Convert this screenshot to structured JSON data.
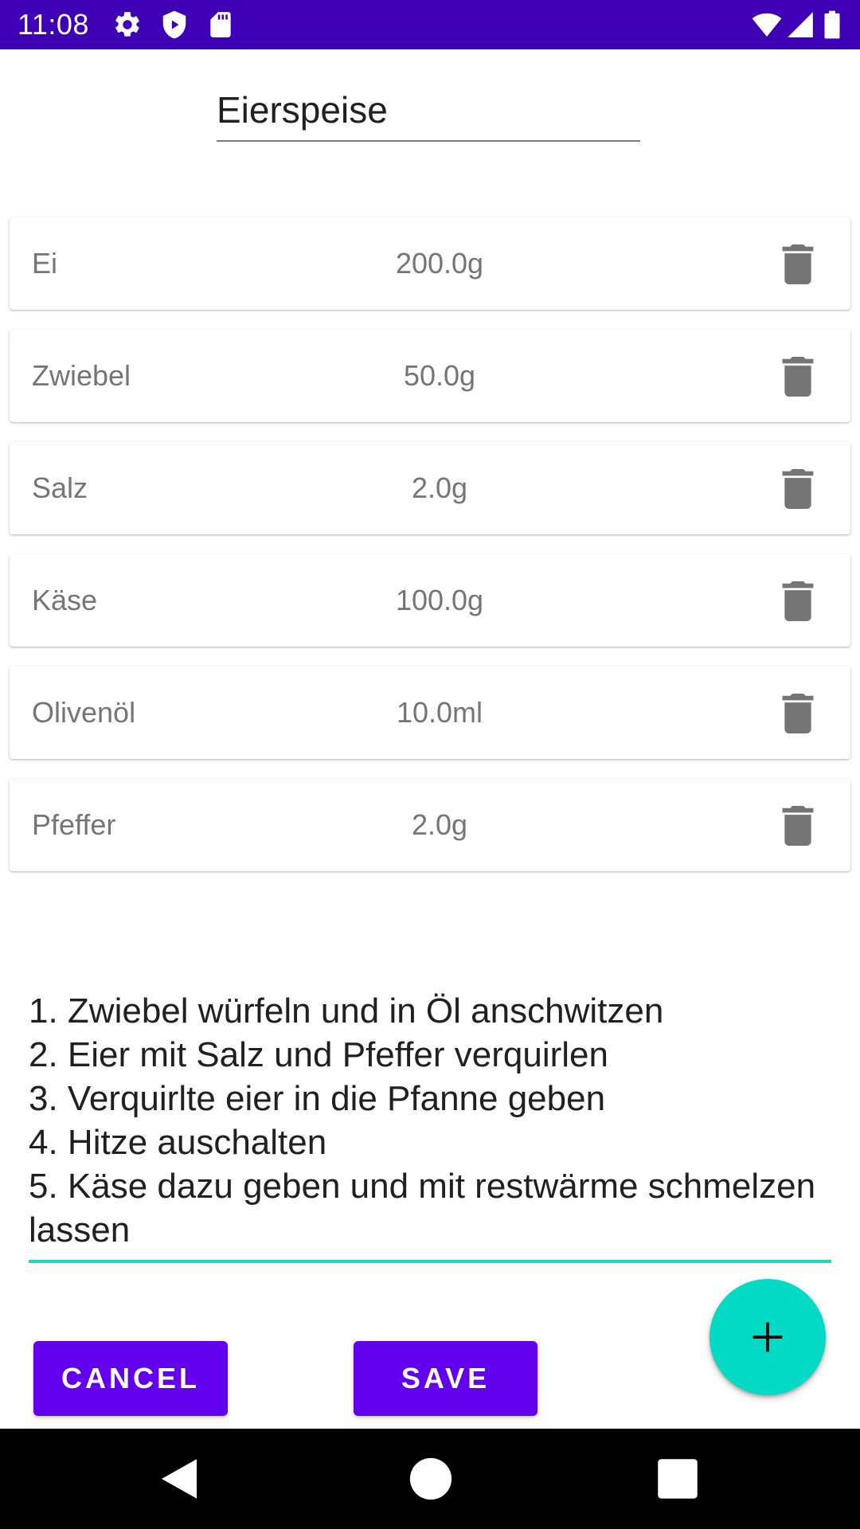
{
  "status_bar": {
    "time": "11:08",
    "background": "#3F00B5"
  },
  "recipe": {
    "title": "Eierspeise"
  },
  "ingredients": [
    {
      "name": "Ei",
      "amount": "200.0g"
    },
    {
      "name": "Zwiebel",
      "amount": "50.0g"
    },
    {
      "name": "Salz",
      "amount": "2.0g"
    },
    {
      "name": "Käse",
      "amount": "100.0g"
    },
    {
      "name": "Olivenöl",
      "amount": "10.0ml"
    },
    {
      "name": "Pfeffer",
      "amount": "2.0g"
    }
  ],
  "instructions": "1. Zwiebel würfeln und in Öl anschwitzen\n2. Eier mit Salz und Pfeffer verquirlen\n3. Verquirlte eier in die Pfanne geben\n4. Hitze auschalten\n5. Käse dazu geben und mit restwärme schmelzen lassen",
  "buttons": {
    "cancel": "CANCEL",
    "save": "SAVE"
  },
  "colors": {
    "primary": "#6200EE",
    "accent": "#03DAC5",
    "status_bar": "#3F00B5"
  },
  "icons": {
    "delete": "trash-icon",
    "fab": "plus-icon",
    "nav_back": "back-triangle-icon",
    "nav_home": "home-circle-icon",
    "nav_recents": "recents-square-icon"
  }
}
